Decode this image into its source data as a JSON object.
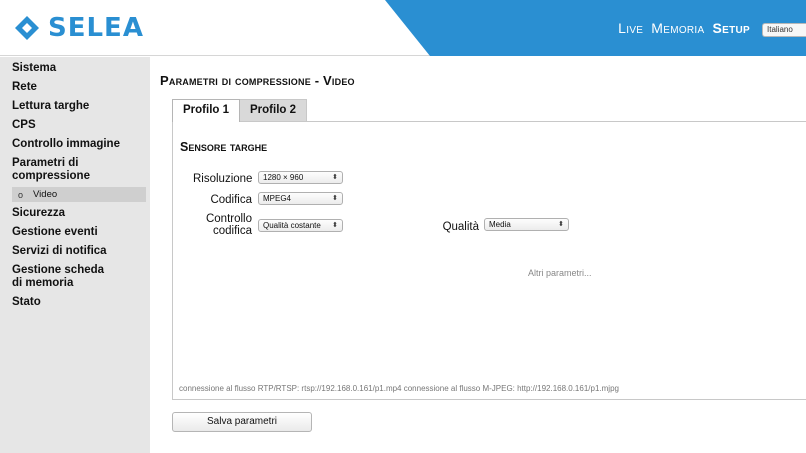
{
  "brand": {
    "name": "SELEA",
    "color": "#2a8fd2"
  },
  "topnav": {
    "items": [
      {
        "label": "Live"
      },
      {
        "label": "Memoria"
      },
      {
        "label": "Setup"
      }
    ],
    "active_item": "Setup",
    "language": "Italiano"
  },
  "sidebar": {
    "items": [
      {
        "label": "Sistema"
      },
      {
        "label": "Rete"
      },
      {
        "label": "Lettura targhe"
      },
      {
        "label": "CPS"
      },
      {
        "label": "Controllo immagine"
      },
      {
        "label": "Parametri di compressione"
      },
      {
        "label": "Sicurezza"
      },
      {
        "label": "Gestione eventi"
      },
      {
        "label": "Servizi di notifica"
      },
      {
        "label": "Gestione scheda di memoria"
      },
      {
        "label": "Stato"
      }
    ],
    "subitem": {
      "label": "Video",
      "bullet": "o"
    }
  },
  "main": {
    "title": "Parametri di compressione - Video",
    "tabs": [
      {
        "label": "Profilo 1",
        "active": true
      },
      {
        "label": "Profilo 2",
        "active": false
      }
    ],
    "section_title": "Sensore targhe",
    "fields": {
      "risoluzione": {
        "label": "Risoluzione",
        "value": "1280 × 960"
      },
      "codifica": {
        "label": "Codifica",
        "value": "MPEG4"
      },
      "controllo_codifica": {
        "label_line1": "Controllo",
        "label_line2": "codifica",
        "value": "Qualità costante"
      },
      "qualita": {
        "label": "Qualità",
        "value": "Media"
      }
    },
    "altri_parametri": "Altri parametri...",
    "stream_info": "connessione al flusso RTP/RTSP: rtsp://192.168.0.161/p1.mp4   connessione al flusso M-JPEG: http://192.168.0.161/p1.mjpg",
    "save_label": "Salva parametri"
  },
  "colors": {
    "header_blue": "#2a8fd2",
    "sidebar_bg": "#e6e6e6",
    "sidebar_selected": "#cfcfcf"
  },
  "icons": {
    "logo_mark": "diamond-chevron-icon",
    "select_arrows": "updown-arrows-icon"
  }
}
